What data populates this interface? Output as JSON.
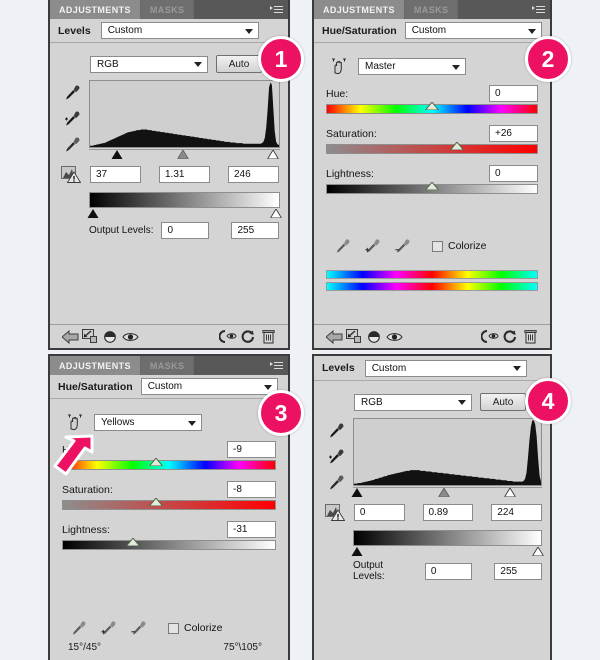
{
  "background_color": "#eef2f7",
  "badge_color": "#ed1164",
  "tabs": {
    "adjustments": "ADJUSTMENTS",
    "masks": "MASKS"
  },
  "badges": {
    "one": "1",
    "two": "2",
    "three": "3",
    "four": "4"
  },
  "panel1": {
    "title": "Levels",
    "preset": "Custom",
    "channel": "RGB",
    "auto_label": "Auto",
    "input_black": "37",
    "input_gamma": "1.31",
    "input_white": "246",
    "output_label": "Output Levels:",
    "output_black": "0",
    "output_white": "255",
    "handles": {
      "black_pct": 14.5,
      "gray_pct": 49,
      "white_pct": 96.5,
      "out_black_pct": 2,
      "out_white_pct": 98
    },
    "histogram": [
      2,
      2,
      2,
      3,
      3,
      4,
      4,
      5,
      5,
      6,
      6,
      7,
      8,
      9,
      10,
      11,
      12,
      13,
      14,
      15,
      16,
      17,
      18,
      19,
      20,
      21,
      22,
      23,
      23,
      24,
      24,
      25,
      25,
      26,
      26,
      26,
      27,
      27,
      27,
      27,
      27,
      26,
      26,
      26,
      25,
      25,
      25,
      24,
      24,
      24,
      23,
      23,
      23,
      22,
      22,
      22,
      21,
      21,
      21,
      20,
      20,
      20,
      19,
      19,
      19,
      18,
      18,
      18,
      17,
      17,
      17,
      16,
      16,
      16,
      15,
      15,
      15,
      14,
      14,
      14,
      13,
      13,
      13,
      12,
      12,
      12,
      11,
      11,
      11,
      10,
      10,
      10,
      9,
      9,
      9,
      8,
      8,
      8,
      8,
      7,
      7,
      7,
      7,
      6,
      6,
      6,
      6,
      6,
      5,
      5,
      5,
      5,
      5,
      5,
      5,
      5,
      5,
      5,
      5,
      5,
      5,
      6,
      8,
      14,
      30,
      58,
      92,
      100,
      96,
      60,
      24,
      8,
      4,
      3
    ]
  },
  "panel2": {
    "title": "Hue/Saturation",
    "preset": "Custom",
    "range": "Master",
    "hue_label": "Hue:",
    "hue_value": "0",
    "saturation_label": "Saturation:",
    "saturation_value": "+26",
    "lightness_label": "Lightness:",
    "lightness_value": "0",
    "colorize_label": "Colorize",
    "handles": {
      "hue_pct": 50,
      "sat_pct": 62,
      "lig_pct": 50
    }
  },
  "panel3": {
    "title": "Hue/Saturation",
    "preset": "Custom",
    "range": "Yellows",
    "hue_label": "Hue:",
    "hue_value": "-9",
    "saturation_label": "Saturation:",
    "saturation_value": "-8",
    "lightness_label": "Lightness:",
    "lightness_value": "-31",
    "colorize_label": "Colorize",
    "range_left": "15°/45°",
    "range_right": "75°\\105°",
    "handles": {
      "hue_pct": 44,
      "sat_pct": 44,
      "lig_pct": 33
    }
  },
  "panel4": {
    "title": "Levels",
    "preset": "Custom",
    "channel": "RGB",
    "auto_label": "Auto",
    "input_black": "0",
    "input_gamma": "0.89",
    "input_white": "224",
    "output_label": "Output Levels:",
    "output_black": "0",
    "output_white": "255",
    "handles": {
      "black_pct": 2,
      "gray_pct": 48,
      "white_pct": 83,
      "out_black_pct": 2,
      "out_white_pct": 98
    },
    "histogram": [
      2,
      2,
      2,
      3,
      3,
      3,
      4,
      4,
      5,
      5,
      6,
      6,
      7,
      7,
      8,
      9,
      9,
      10,
      11,
      11,
      12,
      13,
      13,
      14,
      15,
      15,
      16,
      16,
      17,
      17,
      18,
      18,
      19,
      19,
      20,
      20,
      21,
      21,
      21,
      22,
      22,
      22,
      22,
      22,
      22,
      22,
      21,
      21,
      21,
      21,
      20,
      20,
      20,
      20,
      19,
      19,
      19,
      19,
      18,
      18,
      18,
      18,
      17,
      17,
      17,
      17,
      16,
      16,
      16,
      16,
      15,
      15,
      15,
      15,
      14,
      14,
      14,
      14,
      13,
      13,
      13,
      13,
      12,
      12,
      12,
      12,
      11,
      11,
      11,
      11,
      10,
      10,
      10,
      10,
      9,
      9,
      9,
      9,
      8,
      8,
      8,
      8,
      7,
      7,
      7,
      7,
      6,
      6,
      6,
      6,
      5,
      5,
      5,
      5,
      5,
      5,
      5,
      6,
      9,
      18,
      40,
      66,
      86,
      96,
      96,
      90,
      72,
      40,
      14,
      5
    ]
  },
  "toolbar_icons": [
    "back-arrow",
    "clip-to-layer",
    "view-previous",
    "toggle-visibility",
    "reset-previous",
    "reset",
    "delete"
  ]
}
